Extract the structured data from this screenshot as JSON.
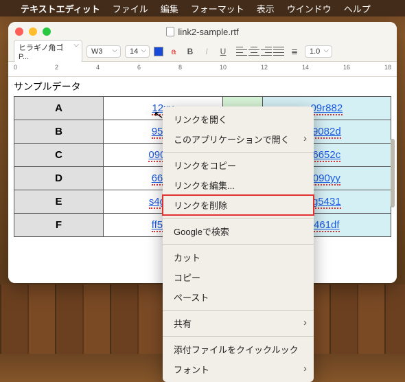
{
  "menubar": {
    "app": "テキストエディット",
    "items": [
      "ファイル",
      "編集",
      "フォーマット",
      "表示",
      "ウインドウ",
      "ヘルプ"
    ]
  },
  "window": {
    "title": "link2-sample.rtf"
  },
  "toolbar": {
    "font": "ヒラギノ角ゴ P...",
    "weight": "W3",
    "size": "14",
    "linespace": "1.0"
  },
  "ruler": {
    "marks": [
      "0",
      "2",
      "4",
      "6",
      "8",
      "10",
      "12",
      "14",
      "16",
      "18"
    ]
  },
  "doc": {
    "heading": "サンプルデータ",
    "rows": [
      {
        "h": "A",
        "c2": "12xy",
        "c3": "",
        "c4": "09r882"
      },
      {
        "h": "B",
        "c2": "956ff",
        "c3": "",
        "c4": "9082d"
      },
      {
        "h": "C",
        "c2": "09022",
        "c3": "",
        "c4": "6652c"
      },
      {
        "h": "D",
        "c2": "66tt2",
        "c3": "",
        "c4": "090yy"
      },
      {
        "h": "E",
        "c2": "s4g82",
        "c3": "",
        "c4": "g5431"
      },
      {
        "h": "F",
        "c2": "ff562",
        "c3": "",
        "c4": "461df"
      }
    ]
  },
  "context": {
    "items": [
      {
        "label": "リンクを開く",
        "arrow": false
      },
      {
        "label": "このアプリケーションで開く",
        "arrow": true
      },
      {
        "sep": true
      },
      {
        "label": "リンクをコピー",
        "arrow": false
      },
      {
        "label": "リンクを編集...",
        "arrow": false
      },
      {
        "label": "リンクを削除",
        "arrow": false,
        "highlight": true
      },
      {
        "sep": true
      },
      {
        "label": "Googleで検索",
        "arrow": false
      },
      {
        "sep": true
      },
      {
        "label": "カット",
        "arrow": false
      },
      {
        "label": "コピー",
        "arrow": false
      },
      {
        "label": "ペースト",
        "arrow": false
      },
      {
        "sep": true
      },
      {
        "label": "共有",
        "arrow": true
      },
      {
        "sep": true
      },
      {
        "label": "添付ファイルをクイックルック",
        "arrow": false
      },
      {
        "label": "フォント",
        "arrow": true
      }
    ]
  }
}
